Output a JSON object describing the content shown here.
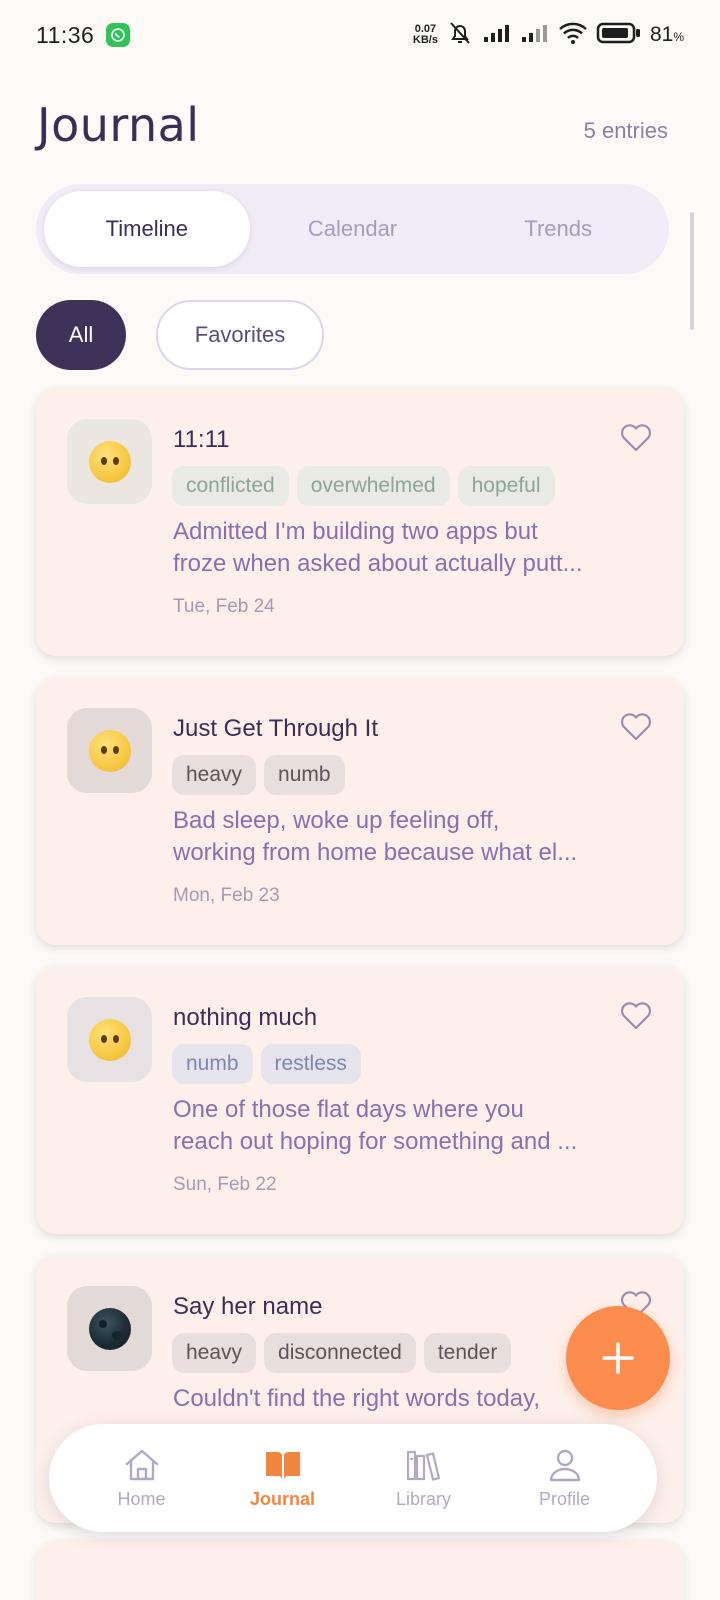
{
  "status_bar": {
    "time": "11:36",
    "net_speed_value": "0.07",
    "net_speed_unit": "KB/s",
    "battery": "81",
    "battery_unit": "%"
  },
  "header": {
    "title": "Journal",
    "entry_count": "5 entries"
  },
  "tabs": [
    {
      "label": "Timeline",
      "active": true
    },
    {
      "label": "Calendar",
      "active": false
    },
    {
      "label": "Trends",
      "active": false
    }
  ],
  "filters": [
    {
      "label": "All",
      "active": true
    },
    {
      "label": "Favorites",
      "active": false
    }
  ],
  "entries": [
    {
      "title": "11:11",
      "emoji": "neutral-face-icon",
      "tags": [
        "conflicted",
        "overwhelmed",
        "hopeful"
      ],
      "snippet_line1": "Admitted I'm building two apps but",
      "snippet_line2": "froze when asked about actually putt...",
      "date": "Tue, Feb 24"
    },
    {
      "title": "Just Get Through It",
      "emoji": "neutral-face-icon",
      "tags": [
        "heavy",
        "numb"
      ],
      "snippet_line1": "Bad sleep, woke up feeling off,",
      "snippet_line2": "working from home because what el...",
      "date": "Mon, Feb 23"
    },
    {
      "title": "nothing much",
      "emoji": "neutral-face-icon",
      "tags": [
        "numb",
        "restless"
      ],
      "snippet_line1": "One of those flat days where you",
      "snippet_line2": "reach out hoping for something and ...",
      "date": "Sun, Feb 22"
    },
    {
      "title": "Say her name",
      "emoji": "new-moon-icon",
      "tags": [
        "heavy",
        "disconnected",
        "tender"
      ],
      "snippet_line1": "Couldn't find the right words today,",
      "snippet_line2": "",
      "date": ""
    }
  ],
  "nav": [
    {
      "label": "Home",
      "icon": "home-icon",
      "active": false
    },
    {
      "label": "Journal",
      "icon": "book-icon",
      "active": true
    },
    {
      "label": "Library",
      "icon": "library-icon",
      "active": false
    },
    {
      "label": "Profile",
      "icon": "profile-icon",
      "active": false
    }
  ],
  "colors": {
    "accent": "#fb8c4e",
    "primary_dark": "#3f3258",
    "card_bg": "#fdf0ea",
    "snippet": "#8a6fae"
  }
}
